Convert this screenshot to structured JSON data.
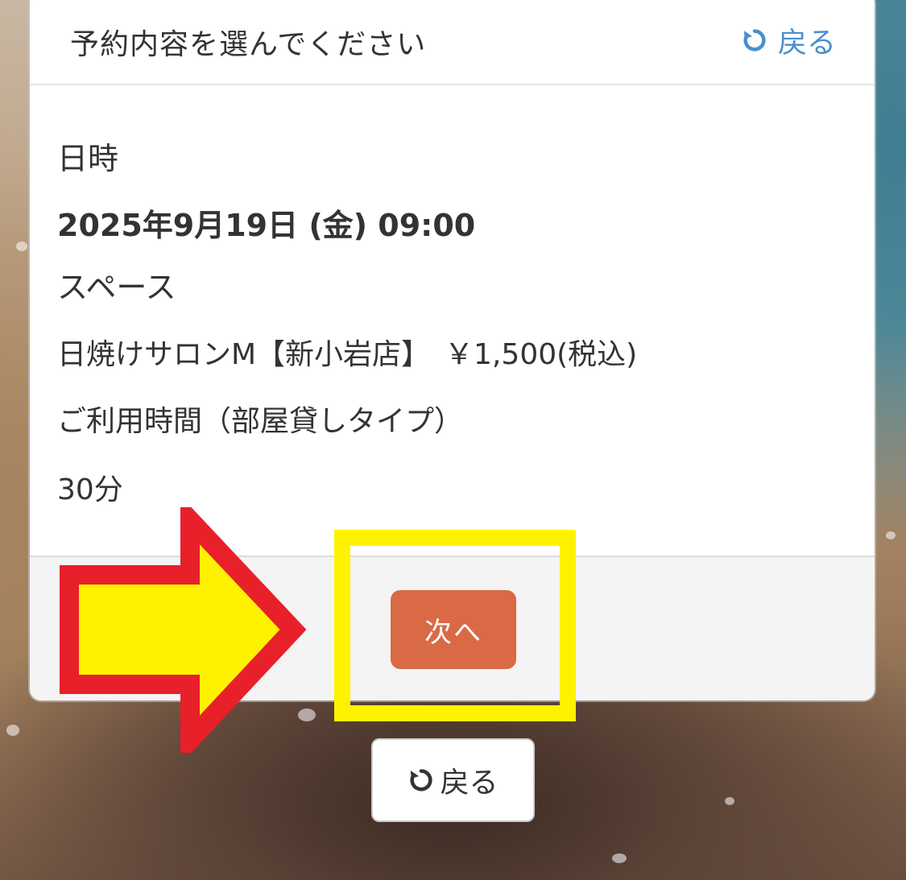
{
  "header": {
    "title": "予約内容を選んでください",
    "back_label": "戻る",
    "back_icon": "undo-icon",
    "back_color": "#4a8fd0"
  },
  "details": {
    "datetime_label": "日時",
    "datetime_value": "2025年9月19日 (金) 09:00",
    "space_label": "スペース",
    "space_value": "日焼けサロンM【新小岩店】　￥1,500(税込)",
    "duration_label": "ご利用時間（部屋貸しタイプ）",
    "duration_value": "30分"
  },
  "footer": {
    "next_label": "次へ",
    "next_color": "#d96a45"
  },
  "bottom": {
    "back_label": "戻る",
    "back_icon": "undo-icon"
  },
  "annotations": {
    "arrow_icon": "right-arrow-icon",
    "arrow_fill": "#fff200",
    "arrow_stroke": "#e8202a",
    "highlight_color": "#fff200"
  }
}
